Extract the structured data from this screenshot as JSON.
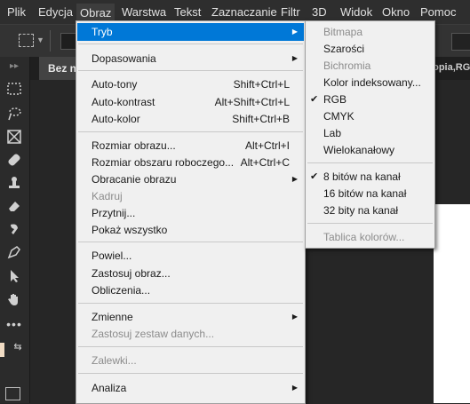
{
  "menubar": {
    "items": [
      "Plik",
      "Edycja",
      "Obraz",
      "Warstwa",
      "Tekst",
      "Zaznaczanie",
      "Filtr",
      "3D",
      "Widok",
      "Okno",
      "Pomoc"
    ]
  },
  "tabs": {
    "active_title": "Bez naz",
    "other_title": "kopia,RG"
  },
  "main_menu": {
    "tryb": "Tryb",
    "dopasowania": "Dopasowania",
    "autotony": "Auto-tony",
    "autotony_sc": "Shift+Ctrl+L",
    "autokontrast": "Auto-kontrast",
    "autokontrast_sc": "Alt+Shift+Ctrl+L",
    "autokolor": "Auto-kolor",
    "autokolor_sc": "Shift+Ctrl+B",
    "rozmiar_obrazu": "Rozmiar obrazu...",
    "rozmiar_obrazu_sc": "Alt+Ctrl+I",
    "rozmiar_obszaru": "Rozmiar obszaru roboczego...",
    "rozmiar_obszaru_sc": "Alt+Ctrl+C",
    "obracanie": "Obracanie obrazu",
    "kadruj": "Kadruj",
    "przytnij": "Przytnij...",
    "pokaz": "Pokaż wszystko",
    "powiel": "Powiel...",
    "zastosuj_obraz": "Zastosuj obraz...",
    "obliczenia": "Obliczenia...",
    "zmienne": "Zmienne",
    "zastosuj_zestaw": "Zastosuj zestaw danych...",
    "zalewki": "Zalewki...",
    "analiza": "Analiza"
  },
  "sub_menu": {
    "bitmapa": "Bitmapa",
    "szarosci": "Szarości",
    "bichromia": "Bichromia",
    "indeksowany": "Kolor indeksowany...",
    "rgb": "RGB",
    "cmyk": "CMYK",
    "lab": "Lab",
    "wielokanalowy": "Wielokanałowy",
    "bit8": "8 bitów na kanał",
    "bit16": "16 bitów na kanał",
    "bit32": "32 bity na kanał",
    "tablica": "Tablica kolorów...",
    "check_mark": "✔"
  },
  "colors": {
    "highlight": "#0078d7",
    "menu_bg": "#f0f0f0",
    "app_bg": "#262626"
  }
}
